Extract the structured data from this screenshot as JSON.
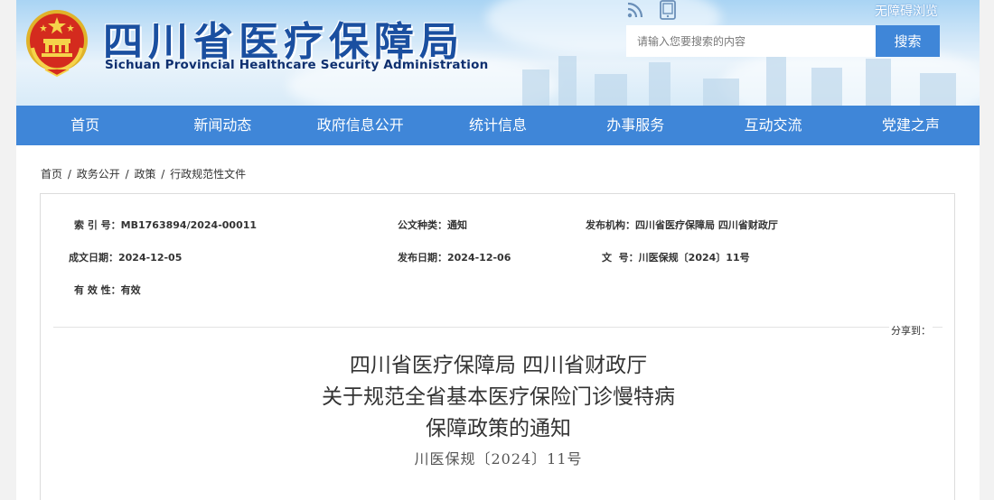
{
  "header": {
    "title": "四川省医疗保障局",
    "subtitle": "Sichuan Provincial Healthcare Security Administration",
    "accessibility_label": "无障碍浏览",
    "search": {
      "placeholder": "请输入您要搜索的内容",
      "button_label": "搜索"
    },
    "icons": [
      "rss-icon",
      "mobile-icon"
    ]
  },
  "nav": {
    "items": [
      {
        "label": "首页"
      },
      {
        "label": "新闻动态"
      },
      {
        "label": "政府信息公开"
      },
      {
        "label": "统计信息"
      },
      {
        "label": "办事服务"
      },
      {
        "label": "互动交流"
      },
      {
        "label": "党建之声"
      }
    ]
  },
  "breadcrumb": {
    "items": [
      "首页",
      "政务公开",
      "政策",
      "行政规范性文件"
    ],
    "separator": "/"
  },
  "meta": {
    "index_label": "索 引 号：",
    "index_value": "MB1763894/2024-00011",
    "doc_type_label": "公文种类：",
    "doc_type_value": "通知",
    "issuer_label": "发布机构：",
    "issuer_value": "四川省医疗保障局 四川省财政厅",
    "written_date_label": "成文日期：",
    "written_date_value": "2024-12-05",
    "publish_date_label": "发布日期：",
    "publish_date_value": "2024-12-06",
    "doc_no_label": "文  号：",
    "doc_no_value": "川医保规〔2024〕11号",
    "validity_label": "有 效 性：",
    "validity_value": "有效"
  },
  "share_label": "分享到：",
  "document": {
    "title_line1": "四川省医疗保障局   四川省财政厅",
    "title_line2": "关于规范全省基本医疗保险门诊慢特病",
    "title_line3": "保障政策的通知",
    "number": "川医保规〔2024〕11号"
  },
  "colors": {
    "nav_bg": "#3f86d8",
    "title_blue": "#1a4fa0"
  }
}
